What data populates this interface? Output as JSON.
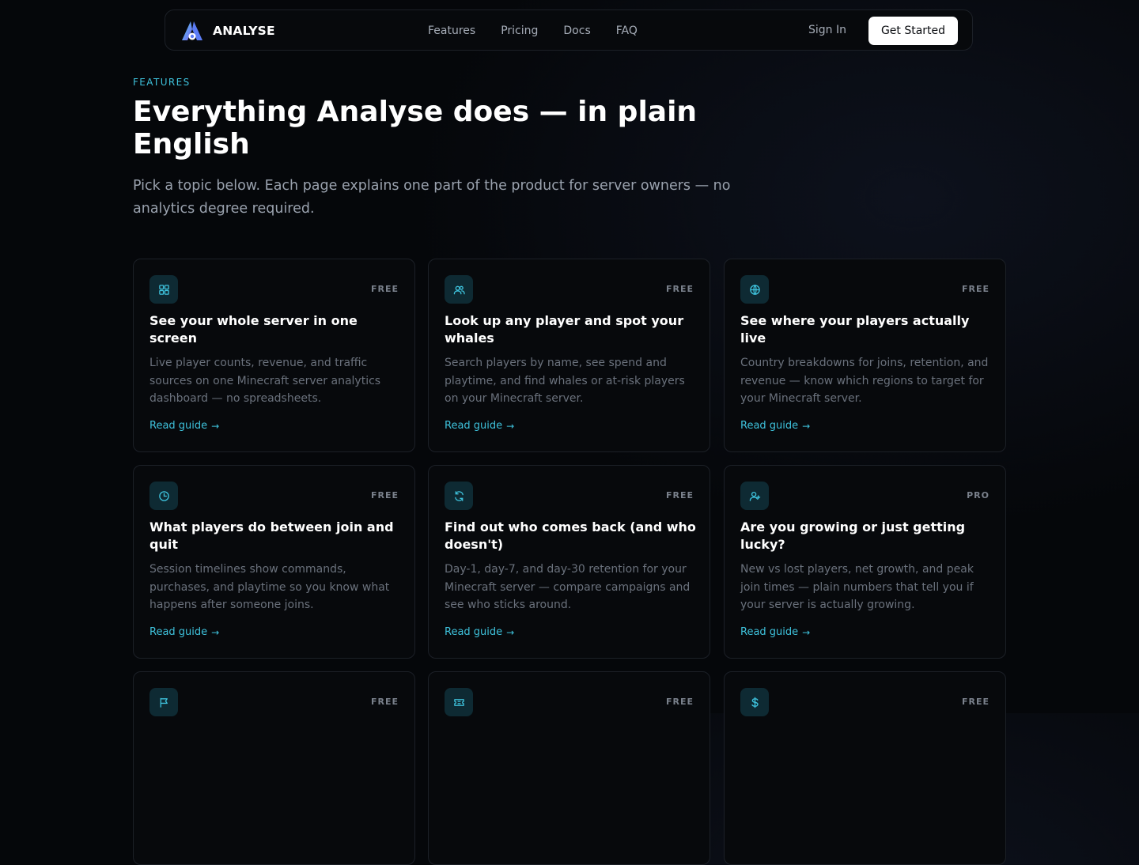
{
  "nav": {
    "brand": "ANALYSE",
    "links": [
      "Features",
      "Pricing",
      "Docs",
      "FAQ"
    ],
    "sign_in": "Sign In",
    "cta": "Get Started"
  },
  "hero": {
    "eyebrow": "FEATURES",
    "title": "Everything Analyse does — in plain English",
    "subtitle": "Pick a topic below. Each page explains one part of the product for server owners — no analytics degree required."
  },
  "accent_color": "#3ec2dc",
  "cards": [
    {
      "icon": "grid-icon",
      "badge": "FREE",
      "title": "See your whole server in one screen",
      "description": "Live player counts, revenue, and traffic sources on one Minecraft server analytics dashboard — no spreadsheets.",
      "link": "Read guide",
      "link_arrow": "→"
    },
    {
      "icon": "users-icon",
      "badge": "FREE",
      "title": "Look up any player and spot your whales",
      "description": "Search players by name, see spend and playtime, and find whales or at-risk players on your Minecraft server.",
      "link": "Read guide",
      "link_arrow": "→"
    },
    {
      "icon": "globe-icon",
      "badge": "FREE",
      "title": "See where your players actually live",
      "description": "Country breakdowns for joins, retention, and revenue — know which regions to target for your Minecraft server.",
      "link": "Read guide",
      "link_arrow": "→"
    },
    {
      "icon": "clock-icon",
      "badge": "FREE",
      "title": "What players do between join and quit",
      "description": "Session timelines show commands, purchases, and playtime so you know what happens after someone joins.",
      "link": "Read guide",
      "link_arrow": "→"
    },
    {
      "icon": "refresh-icon",
      "badge": "FREE",
      "title": "Find out who comes back (and who doesn't)",
      "description": "Day-1, day-7, and day-30 retention for your Minecraft server — compare campaigns and see who sticks around.",
      "link": "Read guide",
      "link_arrow": "→"
    },
    {
      "icon": "user-plus-icon",
      "badge": "PRO",
      "title": "Are you growing or just getting lucky?",
      "description": "New vs lost players, net growth, and peak join times — plain numbers that tell you if your server is actually growing.",
      "link": "Read guide",
      "link_arrow": "→"
    },
    {
      "icon": "flag-icon",
      "badge": "FREE"
    },
    {
      "icon": "ticket-icon",
      "badge": "FREE"
    },
    {
      "icon": "dollar-icon",
      "badge": "FREE"
    }
  ]
}
